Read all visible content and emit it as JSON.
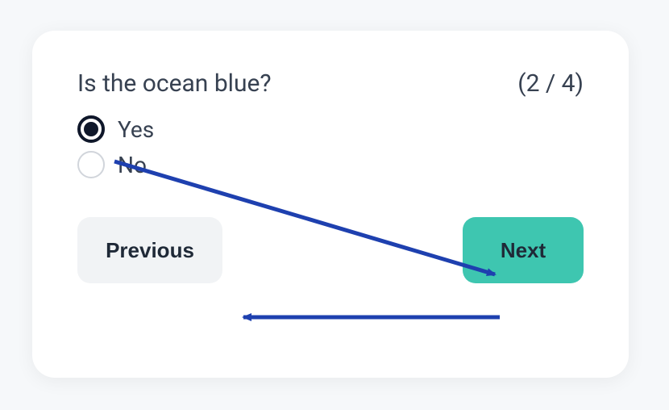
{
  "question": "Is the ocean blue?",
  "counter": "(2 / 4)",
  "options": {
    "yes": {
      "label": "Yes",
      "selected": true
    },
    "no": {
      "label": "No",
      "selected": false
    }
  },
  "buttons": {
    "previous": "Previous",
    "next": "Next"
  },
  "arrows": {
    "color": "#1e40af"
  }
}
